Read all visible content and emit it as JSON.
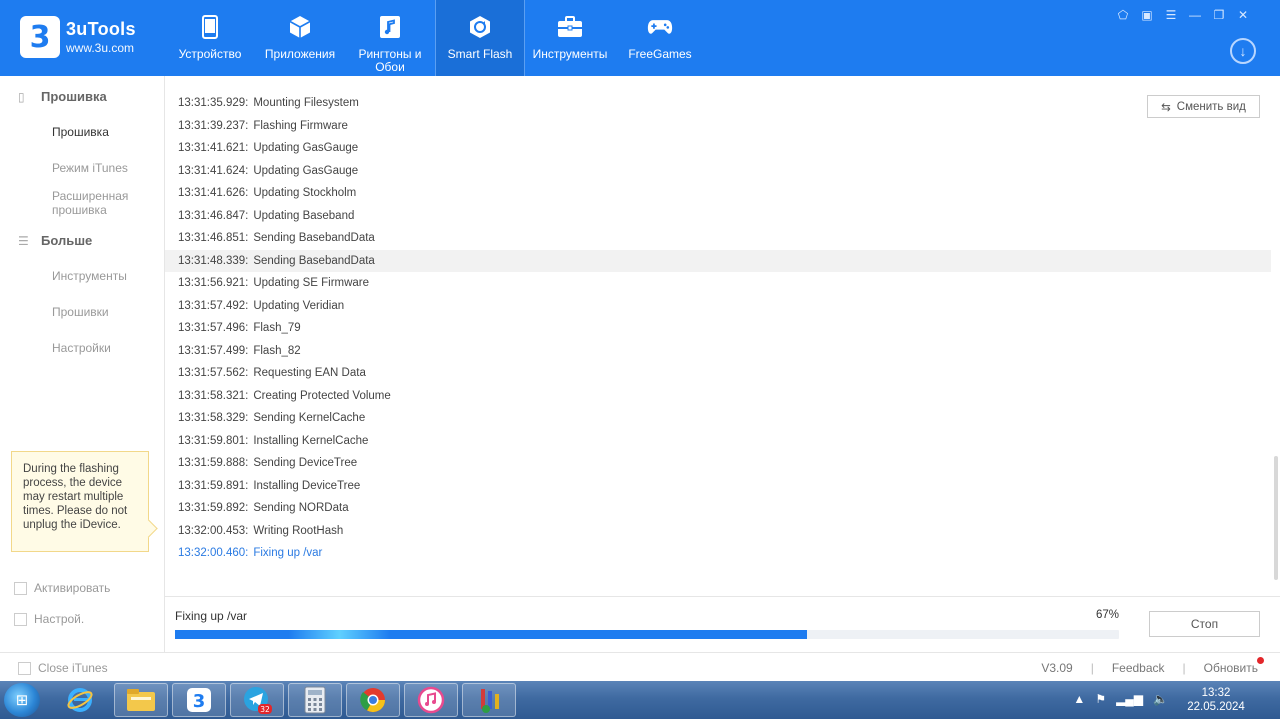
{
  "app": {
    "title": "3uTools",
    "url": "www.3u.com",
    "logo_glyph": "3",
    "brand_color": "#1e7cf0"
  },
  "nav": [
    {
      "label": "Устройство",
      "icon": "phone-icon"
    },
    {
      "label": "Приложения",
      "icon": "cube-icon"
    },
    {
      "label": "Рингтоны и Обои",
      "icon": "music-icon"
    },
    {
      "label": "Smart Flash",
      "icon": "flash-icon",
      "active": true
    },
    {
      "label": "Инструменты",
      "icon": "toolbox-icon"
    },
    {
      "label": "FreeGames",
      "icon": "gamepad-icon"
    }
  ],
  "sidebar": {
    "section1": "Прошивка",
    "items1": [
      "Прошивка",
      "Режим iTunes",
      "Расширенная прошивка"
    ],
    "section2": "Больше",
    "items2": [
      "Инструменты",
      "Прошивки",
      "Настройки"
    ],
    "tip": "During the flashing process, the device may restart multiple times. Please do not unplug the iDevice.",
    "check_activate": "Активировать",
    "check_setup": "Настрой."
  },
  "main": {
    "switch_view": "Сменить вид",
    "log": [
      {
        "time": "13:31:35.929:",
        "msg": "Mounting Filesystem"
      },
      {
        "time": "13:31:39.237:",
        "msg": "Flashing Firmware"
      },
      {
        "time": "13:31:41.621:",
        "msg": "Updating GasGauge"
      },
      {
        "time": "13:31:41.624:",
        "msg": "Updating GasGauge"
      },
      {
        "time": "13:31:41.626:",
        "msg": "Updating Stockholm"
      },
      {
        "time": "13:31:46.847:",
        "msg": "Updating Baseband"
      },
      {
        "time": "13:31:46.851:",
        "msg": "Sending BasebandData"
      },
      {
        "time": "13:31:48.339:",
        "msg": "Sending BasebandData"
      },
      {
        "time": "13:31:56.921:",
        "msg": "Updating SE Firmware"
      },
      {
        "time": "13:31:57.492:",
        "msg": "Updating Veridian"
      },
      {
        "time": "13:31:57.496:",
        "msg": "Flash_79"
      },
      {
        "time": "13:31:57.499:",
        "msg": "Flash_82"
      },
      {
        "time": "13:31:57.562:",
        "msg": "Requesting EAN Data"
      },
      {
        "time": "13:31:58.321:",
        "msg": "Creating Protected Volume"
      },
      {
        "time": "13:31:58.329:",
        "msg": "Sending KernelCache"
      },
      {
        "time": "13:31:59.801:",
        "msg": "Installing KernelCache"
      },
      {
        "time": "13:31:59.888:",
        "msg": "Sending DeviceTree"
      },
      {
        "time": "13:31:59.891:",
        "msg": "Installing DeviceTree"
      },
      {
        "time": "13:31:59.892:",
        "msg": "Sending NORData"
      },
      {
        "time": "13:32:00.453:",
        "msg": "Writing RootHash"
      },
      {
        "time": "13:32:00.460:",
        "msg": "Fixing up /var"
      }
    ],
    "highlight_row": 7,
    "current_color": "#2a7ae2"
  },
  "progress": {
    "label": "Fixing up /var",
    "percent_text": "67%",
    "fraction": 0.67,
    "stop_label": "Стоп"
  },
  "footer": {
    "close_itunes": "Close iTunes",
    "version": "V3.09",
    "feedback": "Feedback",
    "update": "Обновить",
    "sep": "|"
  },
  "taskbar": {
    "time": "13:32",
    "date": "22.05.2024",
    "telegram_badge": "32"
  }
}
